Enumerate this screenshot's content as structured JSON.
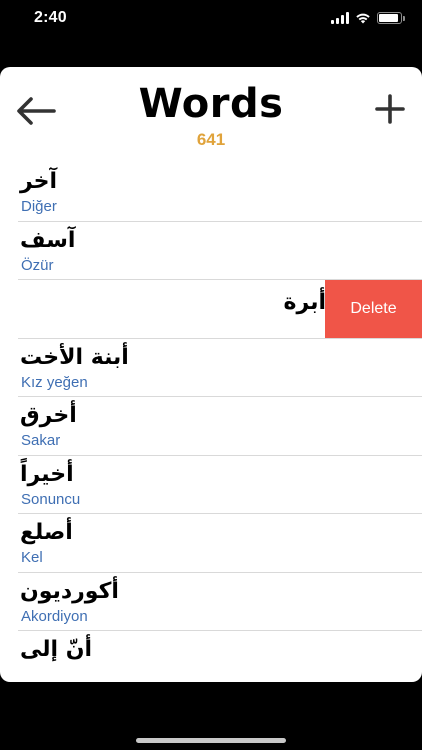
{
  "status_bar": {
    "time": "2:40",
    "battery_level": 0.9
  },
  "header": {
    "title": "Words",
    "count": "641",
    "back_icon": "arrow-left-icon",
    "add_icon": "plus-icon"
  },
  "colors": {
    "count": "#e0a33b",
    "translation": "#3f6fb3",
    "delete": "#f05548"
  },
  "words": [
    {
      "arabic": "آخر",
      "turkish": "Diğer"
    },
    {
      "arabic": "آسف",
      "turkish": "Özür"
    },
    {
      "arabic": "أبرة",
      "turkish": "",
      "swiped": true,
      "delete_label": "Delete"
    },
    {
      "arabic": "أبنة الأخت",
      "turkish": "Kız yeğen"
    },
    {
      "arabic": "أخرق",
      "turkish": "Sakar"
    },
    {
      "arabic": "أخيراً",
      "turkish": "Sonuncu"
    },
    {
      "arabic": "أصلع",
      "turkish": "Kel"
    },
    {
      "arabic": "أكورديون",
      "turkish": "Akordiyon"
    },
    {
      "arabic": "أنّ إلى",
      "turkish": ""
    }
  ]
}
